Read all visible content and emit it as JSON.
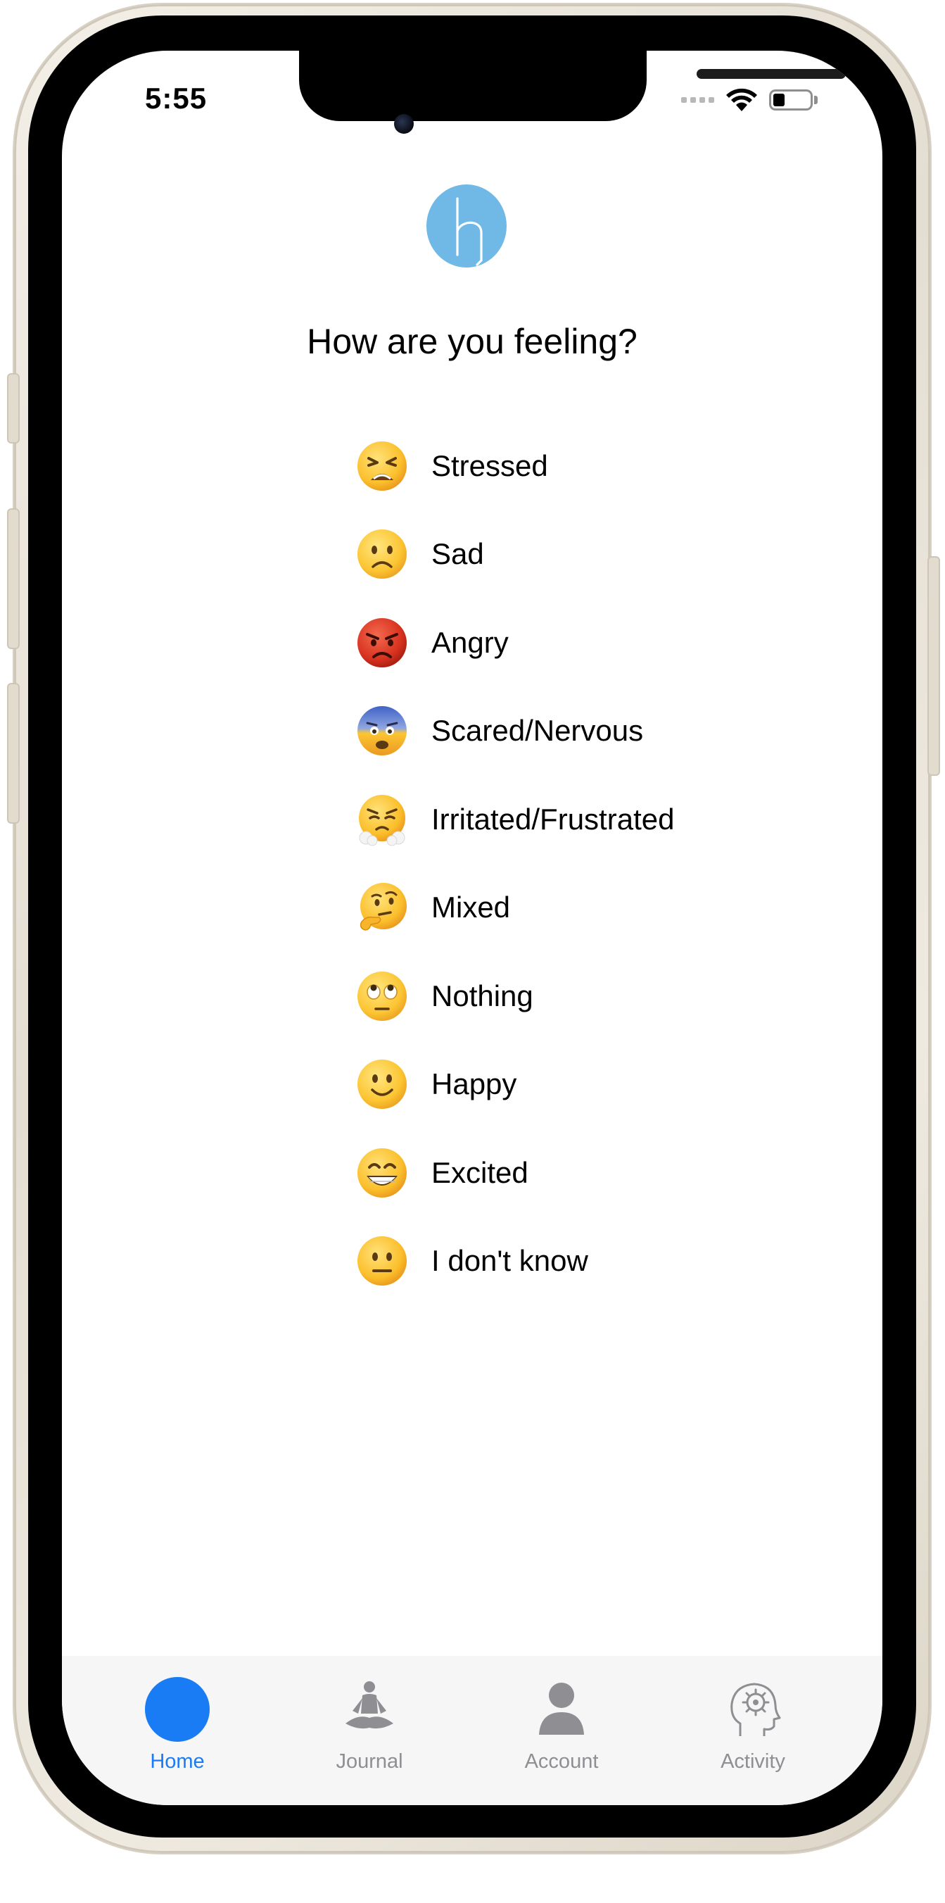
{
  "status_bar": {
    "time": "5:55"
  },
  "logo": {
    "letter": "h",
    "color": "#70b9e6"
  },
  "prompt": {
    "question": "How are you feeling?"
  },
  "moods": [
    {
      "label": "Stressed",
      "icon": "tired-face-emoji"
    },
    {
      "label": "Sad",
      "icon": "frowning-face-emoji"
    },
    {
      "label": "Angry",
      "icon": "pouting-face-emoji"
    },
    {
      "label": "Scared/Nervous",
      "icon": "fearful-face-emoji"
    },
    {
      "label": "Irritated/Frustrated",
      "icon": "face-with-steam-emoji"
    },
    {
      "label": "Mixed",
      "icon": "thinking-face-emoji"
    },
    {
      "label": "Nothing",
      "icon": "rolling-eyes-emoji"
    },
    {
      "label": "Happy",
      "icon": "slightly-smiling-face-emoji"
    },
    {
      "label": "Excited",
      "icon": "grinning-face-emoji"
    },
    {
      "label": "I don't know",
      "icon": "neutral-face-emoji"
    }
  ],
  "tab_bar": {
    "accent": "#1a7cf5",
    "inactive": "#8e8e93",
    "tabs": [
      {
        "label": "Home",
        "icon": "home-circle-icon",
        "active": true
      },
      {
        "label": "Journal",
        "icon": "meditation-icon",
        "active": false
      },
      {
        "label": "Account",
        "icon": "person-icon",
        "active": false
      },
      {
        "label": "Activity",
        "icon": "head-gear-icon",
        "active": false
      }
    ]
  }
}
